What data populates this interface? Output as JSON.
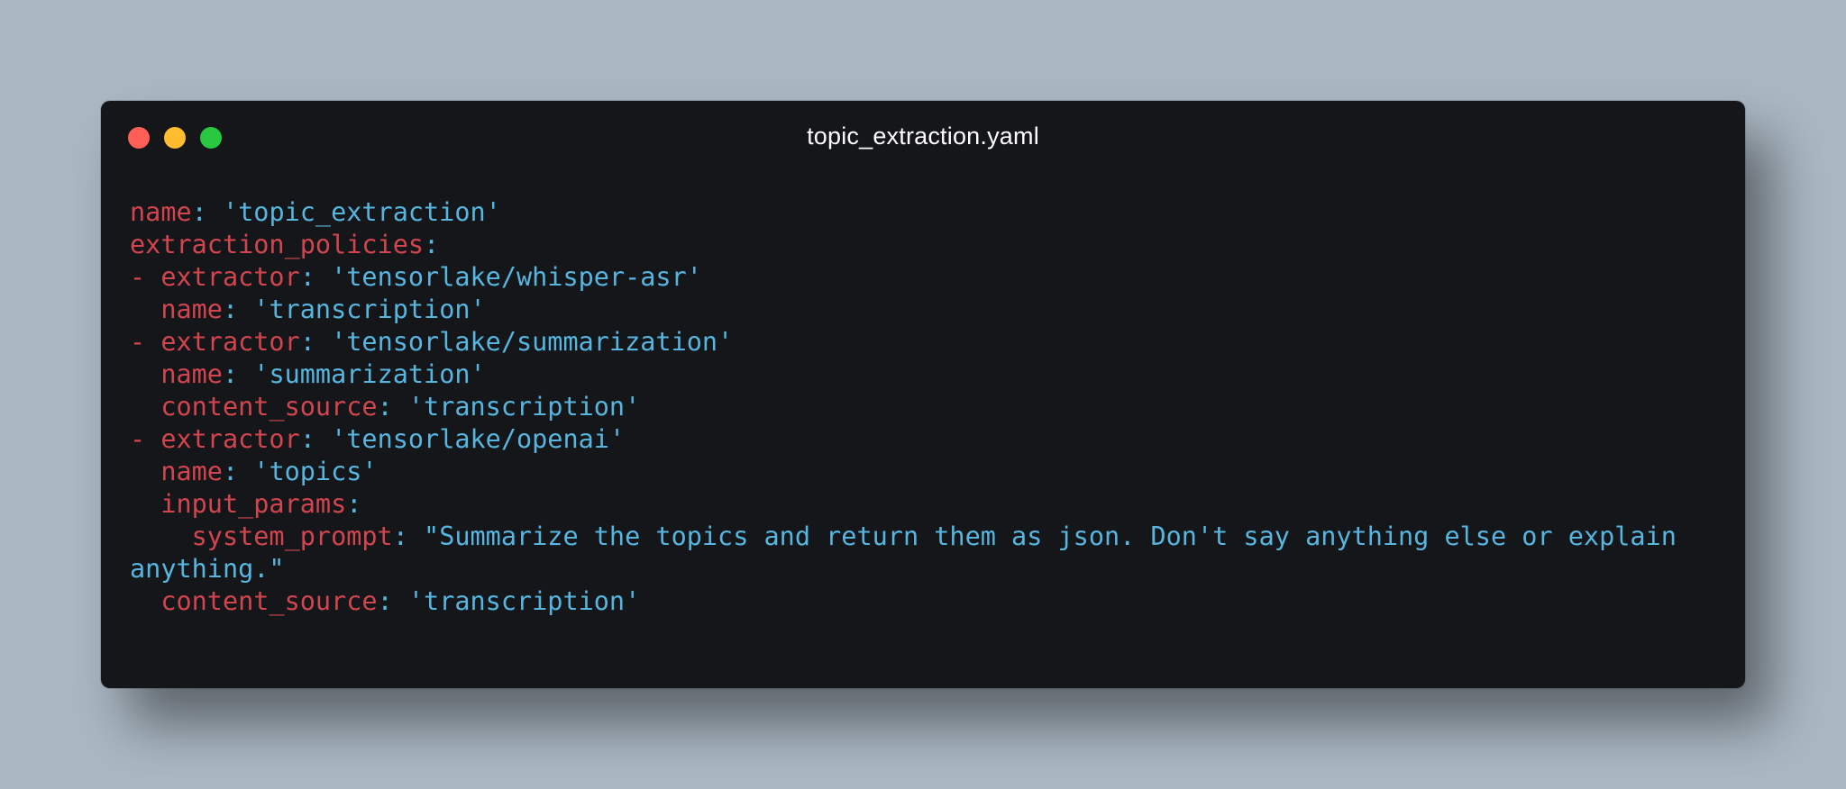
{
  "window": {
    "title": "topic_extraction.yaml",
    "buttons": [
      "close",
      "minimize",
      "zoom"
    ]
  },
  "colors": {
    "background": "#abb8c3",
    "editor_background": "#151619",
    "key": "#d2454f",
    "value": "#56b6e0",
    "close": "#ff5f57",
    "minimize": "#febc2e",
    "zoom": "#28c840"
  },
  "code": {
    "language": "yaml",
    "lines": [
      {
        "indent": "",
        "dash": "",
        "key": "name",
        "sep": ": ",
        "value": "'topic_extraction'"
      },
      {
        "indent": "",
        "dash": "",
        "key": "extraction_policies",
        "sep": ":",
        "value": ""
      },
      {
        "indent": "",
        "dash": "- ",
        "key": "extractor",
        "sep": ": ",
        "value": "'tensorlake/whisper-asr'"
      },
      {
        "indent": "  ",
        "dash": "",
        "key": "name",
        "sep": ": ",
        "value": "'transcription'"
      },
      {
        "indent": "",
        "dash": "- ",
        "key": "extractor",
        "sep": ": ",
        "value": "'tensorlake/summarization'"
      },
      {
        "indent": "  ",
        "dash": "",
        "key": "name",
        "sep": ": ",
        "value": "'summarization'"
      },
      {
        "indent": "  ",
        "dash": "",
        "key": "content_source",
        "sep": ": ",
        "value": "'transcription'"
      },
      {
        "indent": "",
        "dash": "- ",
        "key": "extractor",
        "sep": ": ",
        "value": "'tensorlake/openai'"
      },
      {
        "indent": "  ",
        "dash": "",
        "key": "name",
        "sep": ": ",
        "value": "'topics'"
      },
      {
        "indent": "  ",
        "dash": "",
        "key": "input_params",
        "sep": ":",
        "value": ""
      },
      {
        "indent": "    ",
        "dash": "",
        "key": "system_prompt",
        "sep": ": ",
        "value": "\"Summarize the topics and return them as json. Don't say anything else or explain anything.\""
      },
      {
        "indent": "  ",
        "dash": "",
        "key": "content_source",
        "sep": ": ",
        "value": "'transcription'"
      }
    ]
  }
}
